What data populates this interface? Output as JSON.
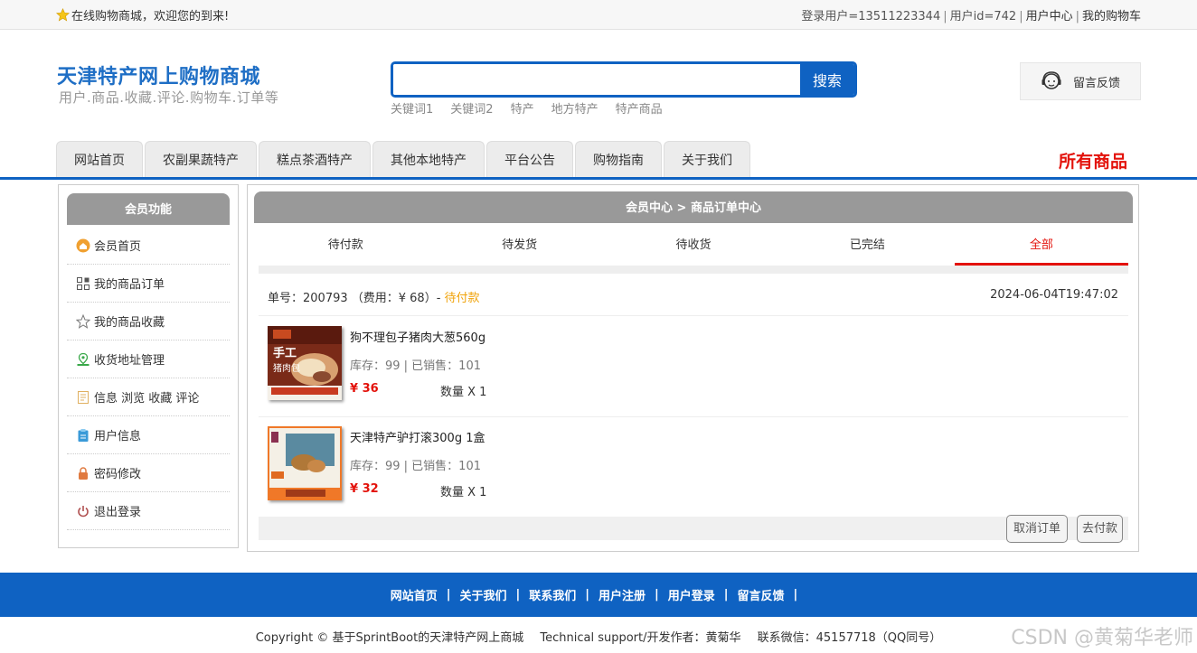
{
  "topbar": {
    "welcome": "在线购物商城，欢迎您的到来!",
    "login_user": "登录用户=13511223344",
    "user_id": "用户id=742",
    "user_center": "用户中心",
    "cart": "我的购物车"
  },
  "header": {
    "title": "天津特产网上购物商城",
    "subtitle": "用户.商品.收藏.评论.购物车.订单等",
    "search_button": "搜索",
    "search_value": "",
    "keywords": [
      "关键词1",
      "关键词2",
      "特产",
      "地方特产",
      "特产商品"
    ],
    "feedback": "留言反馈"
  },
  "nav": {
    "tabs": [
      "网站首页",
      "农副果蔬特产",
      "糕点茶酒特产",
      "其他本地特产",
      "平台公告",
      "购物指南",
      "关于我们"
    ],
    "all_goods": "所有商品"
  },
  "sidebar": {
    "title": "会员功能",
    "items": [
      {
        "label": "会员首页",
        "icon": "home-icon",
        "color": "#f0a030"
      },
      {
        "label": "我的商品订单",
        "icon": "grid-icon",
        "color": "#555555"
      },
      {
        "label": "我的商品收藏",
        "icon": "star-outline-icon",
        "color": "#777777"
      },
      {
        "label": "收货地址管理",
        "icon": "location-icon",
        "color": "#3aa84a"
      },
      {
        "label": "信息 浏览 收藏 评论",
        "icon": "document-icon",
        "color": "#e0b060"
      },
      {
        "label": "用户信息",
        "icon": "clipboard-icon",
        "color": "#3a9ad8"
      },
      {
        "label": "密码修改",
        "icon": "lock-icon",
        "color": "#e07a40"
      },
      {
        "label": "退出登录",
        "icon": "power-icon",
        "color": "#b05050"
      }
    ]
  },
  "main": {
    "breadcrumb": "会员中心 > 商品订单中心",
    "status_tabs": [
      "待付款",
      "待发货",
      "待收货",
      "已完结",
      "全部"
    ],
    "active_tab": "全部",
    "order": {
      "number_label": "单号：200793 （费用：¥ 68）-",
      "status": "待付款",
      "time": "2024-06-04T19:47:02",
      "items": [
        {
          "name": "狗不理包子猪肉大葱560g",
          "stock": "库存：99 | 已销售：101",
          "price": "¥ 36",
          "qty": "数量 X 1",
          "thumb_text": "手工 猪肉包"
        },
        {
          "name": "天津特产驴打滚300g 1盒",
          "stock": "库存：99 | 已销售：101",
          "price": "¥ 32",
          "qty": "数量 X 1",
          "thumb_text": ""
        }
      ],
      "cancel_button": "取消订单",
      "pay_button": "去付款"
    }
  },
  "footer": {
    "links": [
      "网站首页",
      "关于我们",
      "联系我们",
      "用户注册",
      "用户登录",
      "留言反馈"
    ],
    "copyright": "Copyright © 基于SprintBoot的天津特产网上商城",
    "support": "Technical support/开发作者：黄菊华",
    "contact": "联系微信：45157718（QQ同号）",
    "watermark": "CSDN @黄菊华老师"
  },
  "colors": {
    "brand_blue": "#0f62c2",
    "accent_red": "#e3120b",
    "pending_orange": "#f0a30a"
  }
}
